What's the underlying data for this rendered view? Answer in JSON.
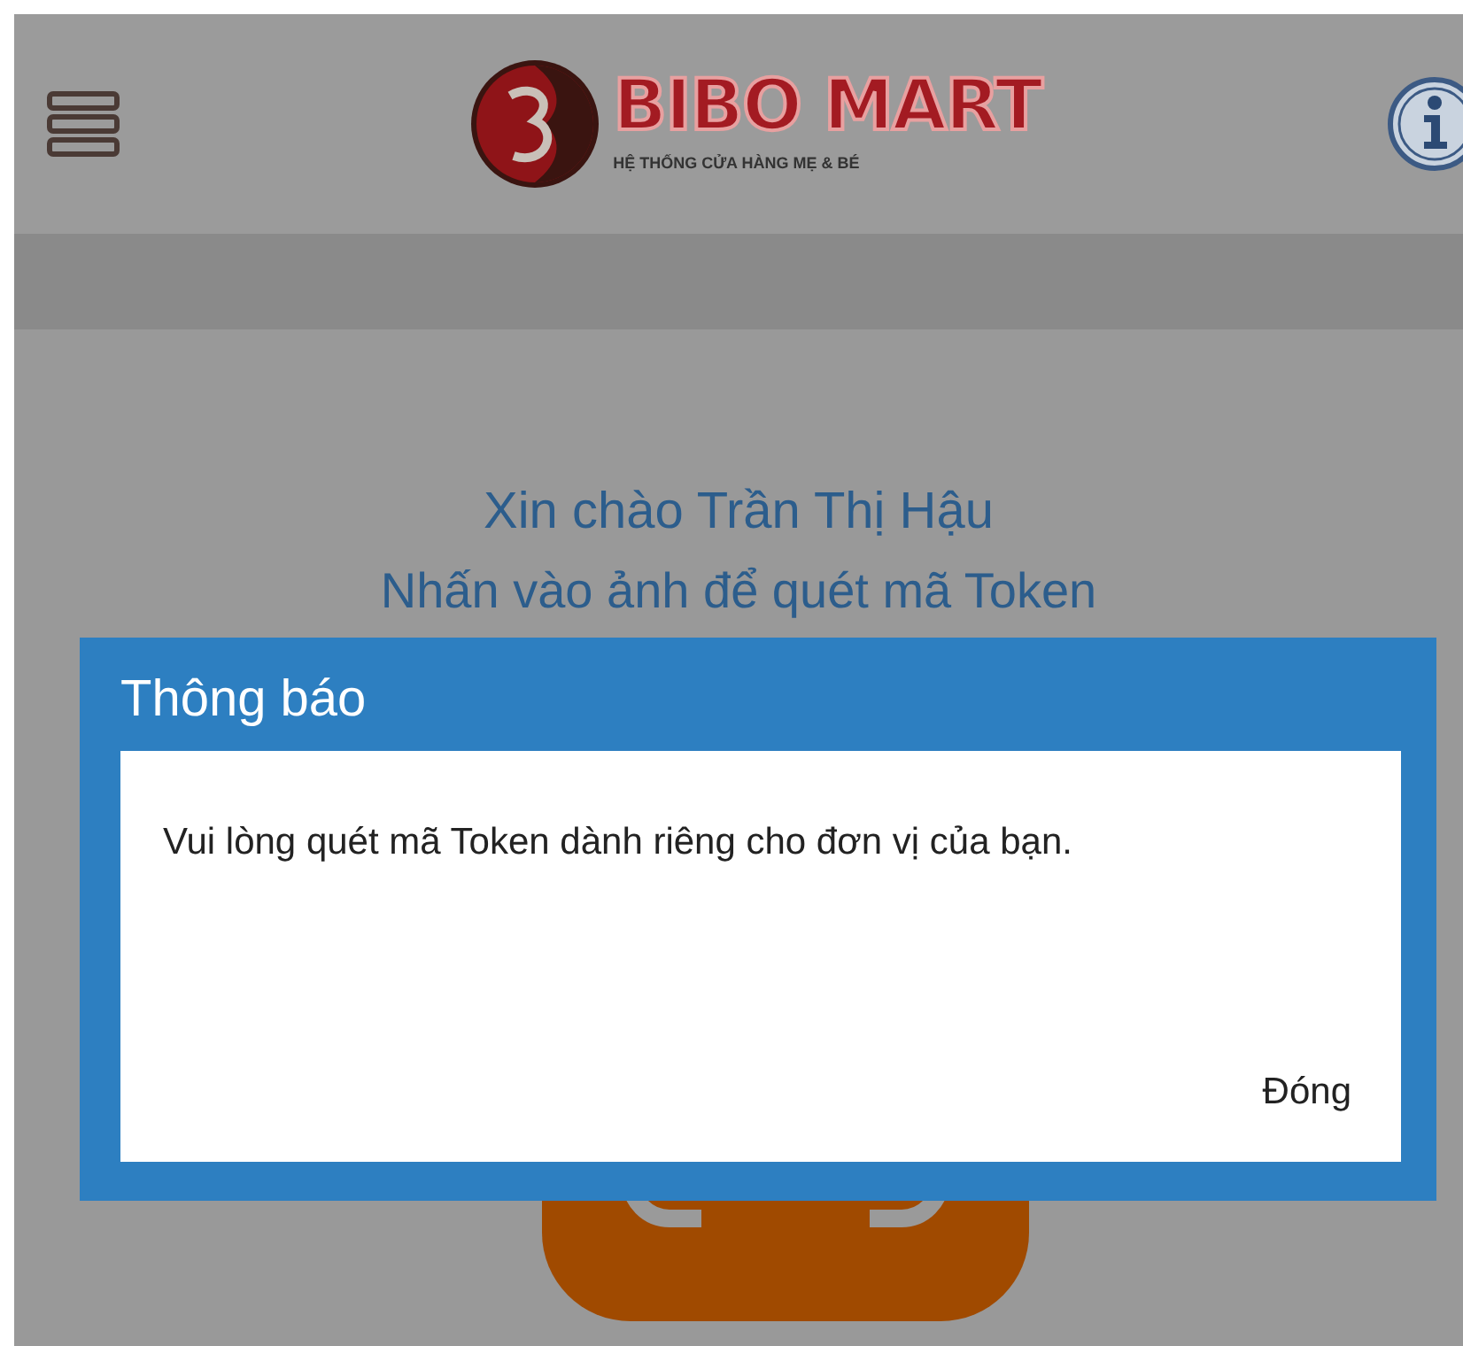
{
  "header": {
    "logo": {
      "name": "BIBO MART",
      "tagline": "HỆ THỐNG CỬA HÀNG MẸ & BÉ"
    }
  },
  "greeting": "Xin chào Trần Thị Hậu",
  "instruction": "Nhấn vào ảnh để quét mã Token",
  "dialog": {
    "title": "Thông báo",
    "message": "Vui lòng quét mã Token dành riêng cho đơn vị của bạn.",
    "buttons": [
      "Đóng"
    ]
  }
}
